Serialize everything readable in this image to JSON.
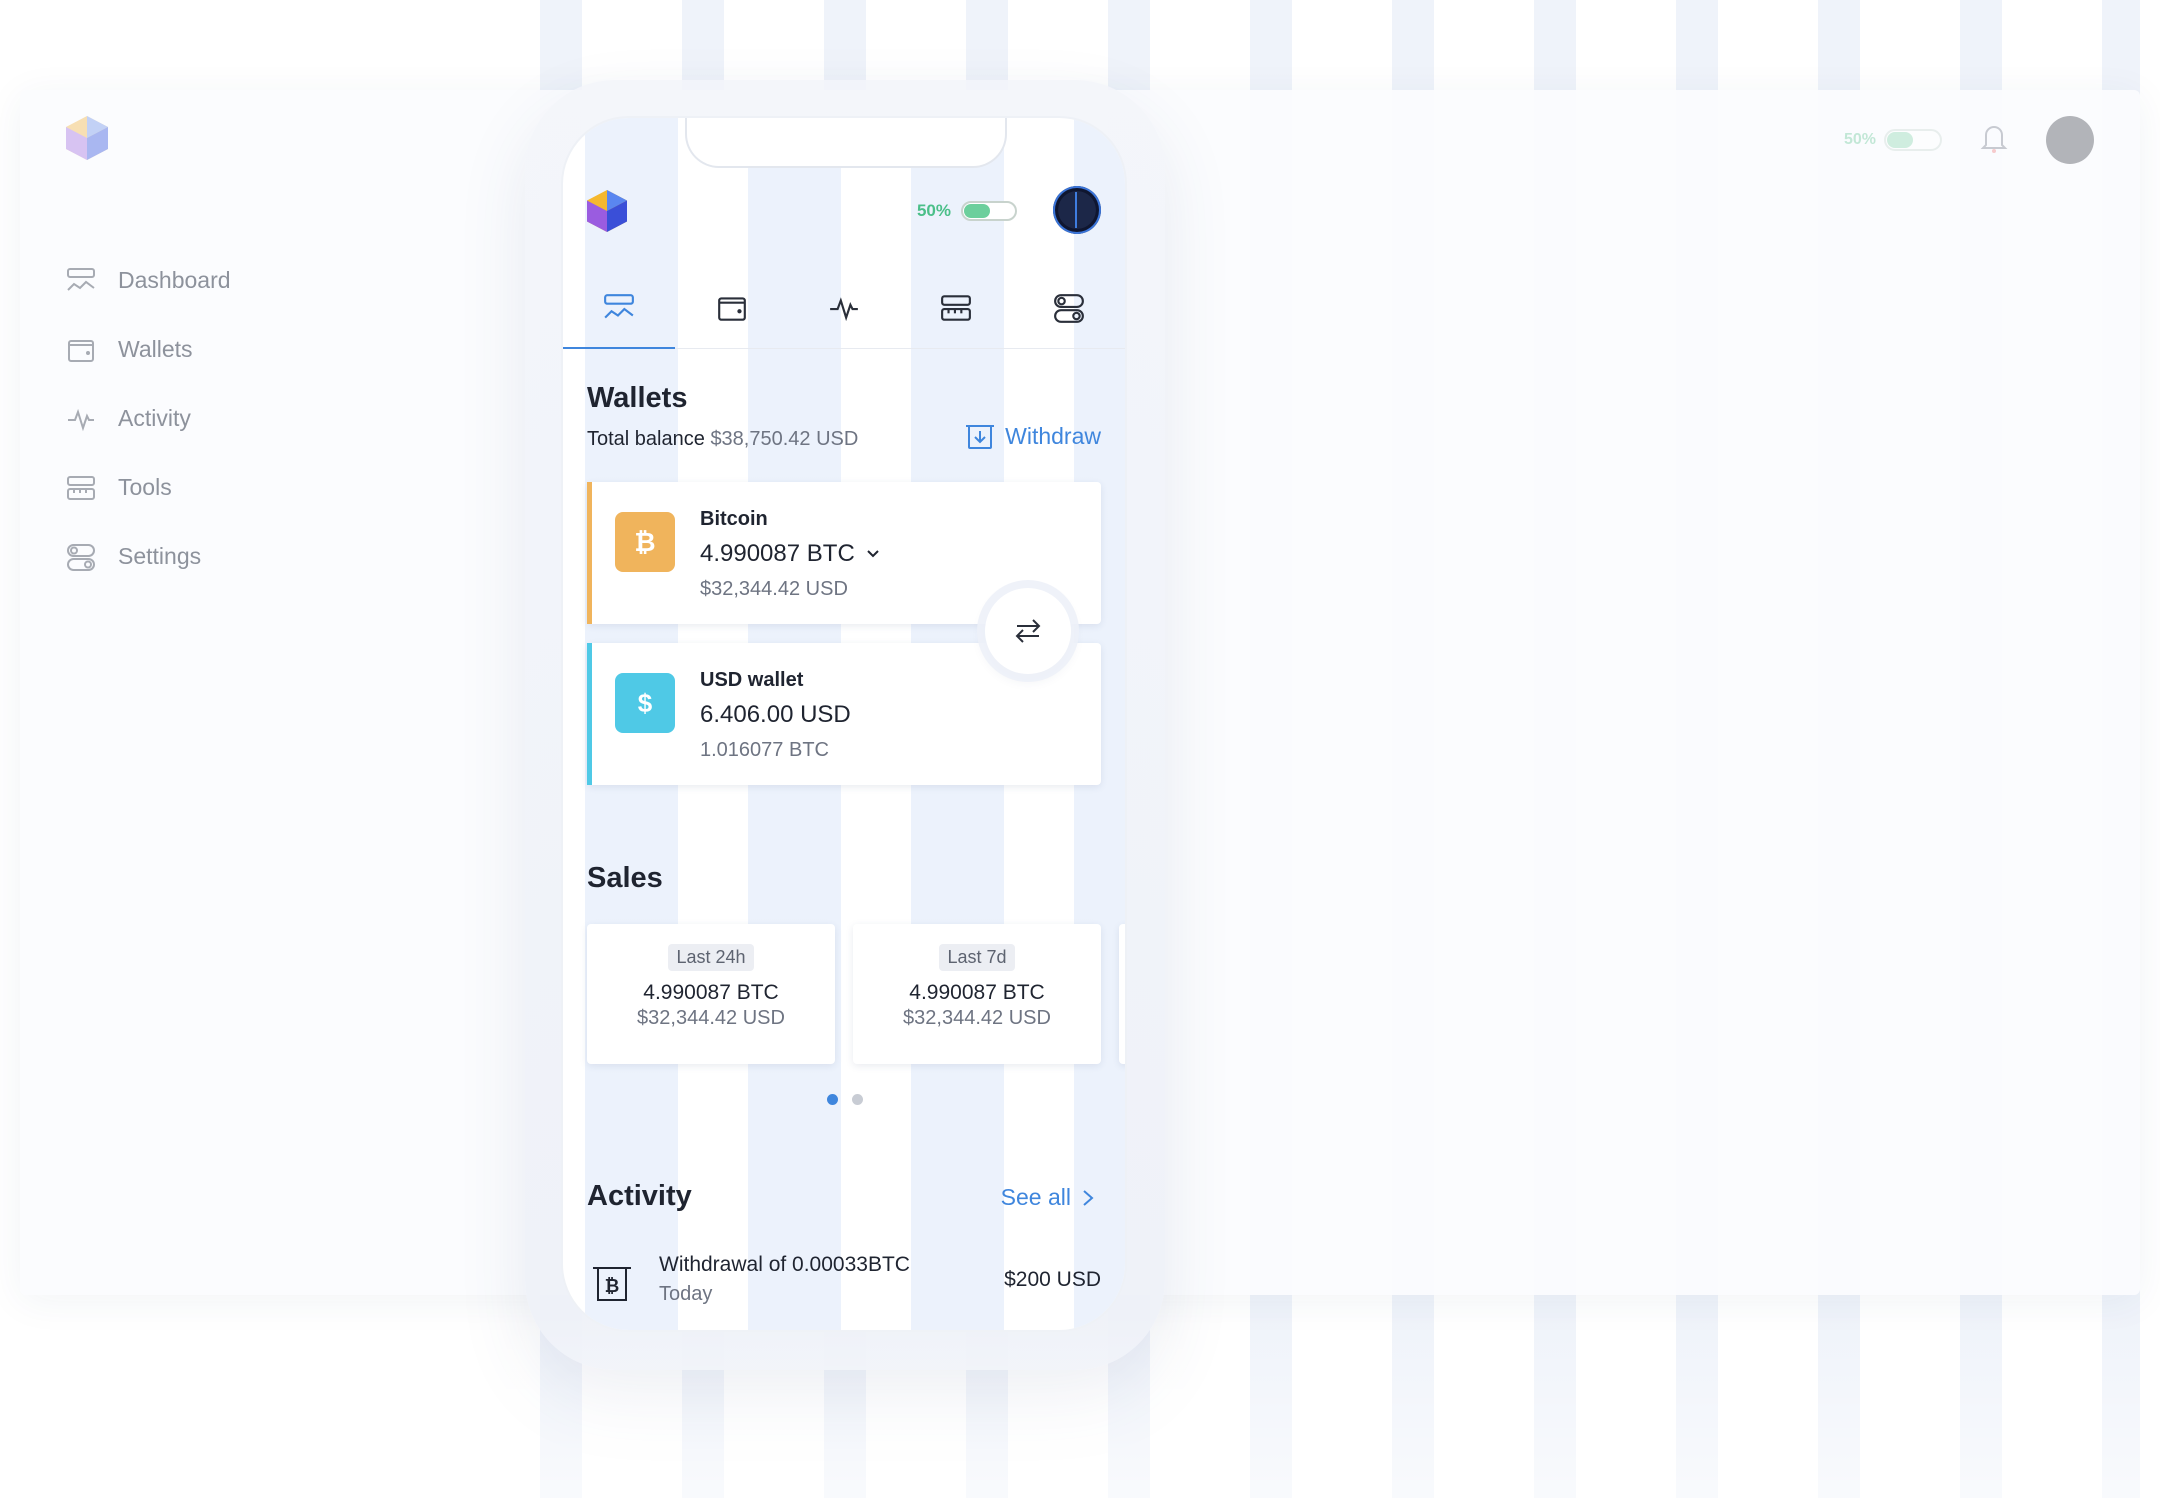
{
  "desktop": {
    "sidebar": {
      "items": [
        {
          "label": "Dashboard",
          "icon": "dashboard-icon"
        },
        {
          "label": "Wallets",
          "icon": "wallet-icon"
        },
        {
          "label": "Activity",
          "icon": "activity-icon"
        },
        {
          "label": "Tools",
          "icon": "tools-icon"
        },
        {
          "label": "Settings",
          "icon": "settings-icon"
        }
      ]
    },
    "topbar": {
      "battery_pct": "50%"
    }
  },
  "phone": {
    "battery_pct": "50%",
    "tabs": [
      "dashboard",
      "wallets",
      "activity",
      "tools",
      "settings"
    ],
    "active_tab": "dashboard",
    "wallets": {
      "title": "Wallets",
      "total_label": "Total balance",
      "total_amount": "$38,750.42 USD",
      "withdraw_label": "Withdraw",
      "cards": [
        {
          "name": "Bitcoin",
          "symbol": "₿",
          "value": "4.990087 BTC",
          "sub": "$32,344.42 USD",
          "color": "#f0b45c"
        },
        {
          "name": "USD wallet",
          "symbol": "$",
          "value": "6.406.00 USD",
          "sub": "1.016077 BTC",
          "color": "#4fc9e6"
        }
      ]
    },
    "sales": {
      "title": "Sales",
      "cards": [
        {
          "period": "Last 24h",
          "btc": "4.990087 BTC",
          "usd": "$32,344.42 USD"
        },
        {
          "period": "Last 7d",
          "btc": "4.990087 BTC",
          "usd": "$32,344.42 USD"
        }
      ],
      "page": 1,
      "pages": 2
    },
    "activity": {
      "title": "Activity",
      "see_all": "See all",
      "items": [
        {
          "title": "Withdrawal of 0.00033BTC",
          "date": "Today",
          "amount": "$200 USD"
        }
      ]
    }
  },
  "colors": {
    "accent": "#3f86dd",
    "success": "#4bbf89",
    "bitcoin": "#f0b45c",
    "usd": "#4fc9e6"
  }
}
